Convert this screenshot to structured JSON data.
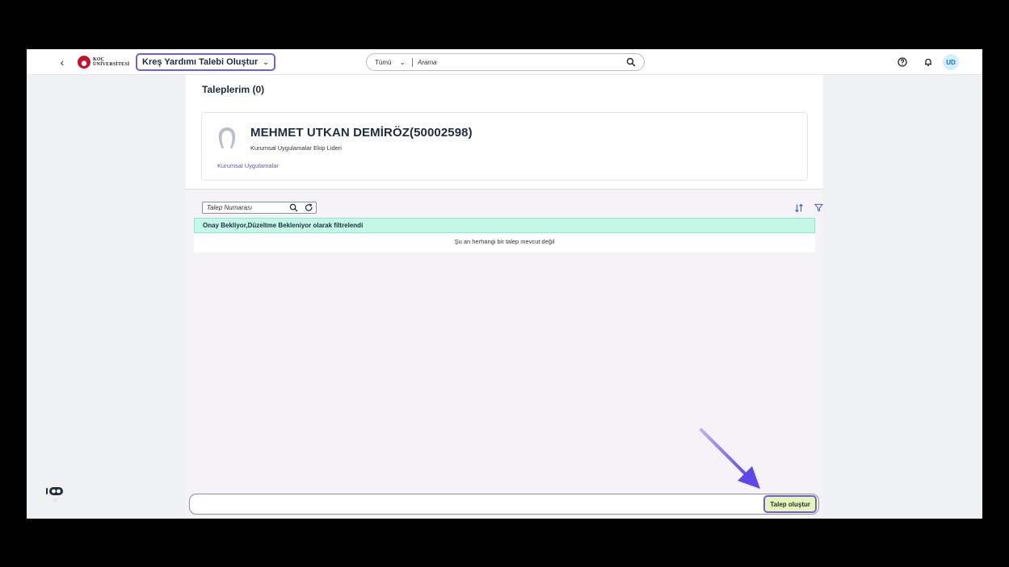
{
  "shellbar": {
    "logo_text_line1": "KOÇ",
    "logo_text_line2": "ÜNİVERSİTESİ",
    "app_title": "Kreş Yardımı Talebi Oluştur",
    "search_scope": "Tümü",
    "search_placeholder": "Arama",
    "avatar_initials": "UD"
  },
  "page": {
    "title": "Taleplerim (0)"
  },
  "profile": {
    "name": "MEHMET UTKAN DEMİRÖZ(50002598)",
    "role": "Kurumsal Uygulamalar Ekip Lideri",
    "department": "Kurumsal Uygulamalar"
  },
  "list": {
    "search_placeholder": "Talep Numarası",
    "filter_info": "Onay Bekliyor,Düzeltme Bekleniyor olarak filtrelendi",
    "empty_text": "Şu an herhangi bir talep mevcut değil"
  },
  "footer": {
    "create_button": "Talep oluştur"
  },
  "colors": {
    "accent": "#6e5ee0",
    "filter_bar": "#c5f7e7",
    "create_button_bg": "#e7f5b9",
    "arrow": "#6b57ee"
  },
  "icons": [
    "back-icon",
    "koc-logo-icon",
    "chevron-down-icon",
    "search-icon",
    "help-icon",
    "bell-icon",
    "person-icon",
    "refresh-icon",
    "sort-icon",
    "filter-icon",
    "assistant-icon",
    "arrow-annotation-icon"
  ]
}
